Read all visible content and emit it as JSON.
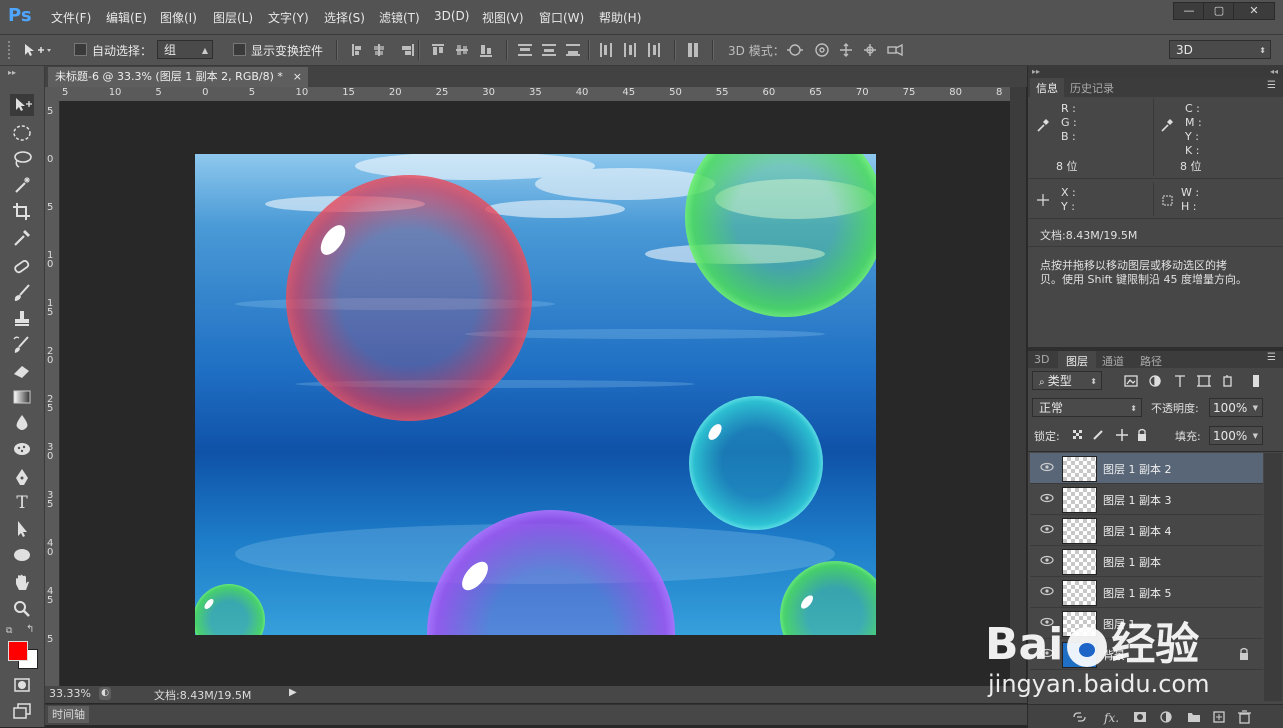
{
  "app": {
    "logo": "Ps"
  },
  "menu": [
    "文件(F)",
    "编辑(E)",
    "图像(I)",
    "图层(L)",
    "文字(Y)",
    "选择(S)",
    "滤镜(T)",
    "3D(D)",
    "视图(V)",
    "窗口(W)",
    "帮助(H)"
  ],
  "window_controls": {
    "minimize": "—",
    "restore": "▢",
    "close": "✕"
  },
  "options": {
    "auto_select_label": "自动选择：",
    "auto_select_value": "组",
    "show_transform_label": "显示变换控件",
    "mode3d_label": "3D 模式：",
    "workspace_value": "3D"
  },
  "document": {
    "tab_title": "未标题-6 @ 33.3% (图层 1 副本 2, RGB/8) *",
    "close": "×"
  },
  "ruler_h": [
    "5",
    "10",
    "5",
    "0",
    "5",
    "10",
    "15",
    "20",
    "25",
    "30",
    "35",
    "40",
    "45",
    "50",
    "55",
    "60",
    "65",
    "70",
    "75",
    "80",
    "8"
  ],
  "ruler_v": [
    "5",
    "0",
    "5",
    "1 0",
    "1 5",
    "2 0",
    "2 5",
    "3 0",
    "3 5",
    "4 0",
    "4 5",
    "5"
  ],
  "status": {
    "zoom": "33.33%",
    "doc": "文档:8.43M/19.5M"
  },
  "timeline": {
    "label": "时间轴"
  },
  "info_panel": {
    "tabs": [
      "信息",
      "历史记录"
    ],
    "rgb_labels": [
      "R :",
      "G :",
      "B :"
    ],
    "cmyk_labels": [
      "C :",
      "M :",
      "Y :",
      "K :"
    ],
    "bits_left": "8 位",
    "bits_right": "8 位",
    "xy_labels": [
      "X :",
      "Y :"
    ],
    "wh_labels": [
      "W :",
      "H :"
    ],
    "doc": "文档:8.43M/19.5M",
    "hint_line1": "点按并拖移以移动图层或移动选区的拷",
    "hint_line2": "贝。使用 Shift 键限制沿 45 度增量方向。"
  },
  "layers_panel": {
    "tabs": [
      "3D",
      "图层",
      "通道",
      "路径"
    ],
    "filter_label": "类型",
    "blend_mode": "正常",
    "opacity_label": "不透明度:",
    "opacity_value": "100%",
    "lock_label": "锁定:",
    "fill_label": "填充:",
    "fill_value": "100%",
    "layers": [
      {
        "name": "图层 1 副本 2",
        "selected": true
      },
      {
        "name": "图层 1 副本 3",
        "selected": false
      },
      {
        "name": "图层 1 副本 4",
        "selected": false
      },
      {
        "name": "图层 1 副本",
        "selected": false
      },
      {
        "name": "图层 1 副本 5",
        "selected": false
      },
      {
        "name": "图层 1",
        "selected": false
      },
      {
        "name": "背景",
        "selected": false
      }
    ]
  },
  "watermark": {
    "brand": "Bai",
    "brand2": "经验",
    "url": "jingyan.baidu.com"
  },
  "colors": {
    "foreground": "#ff0000",
    "background": "#ffffff",
    "accent": "#596678"
  }
}
